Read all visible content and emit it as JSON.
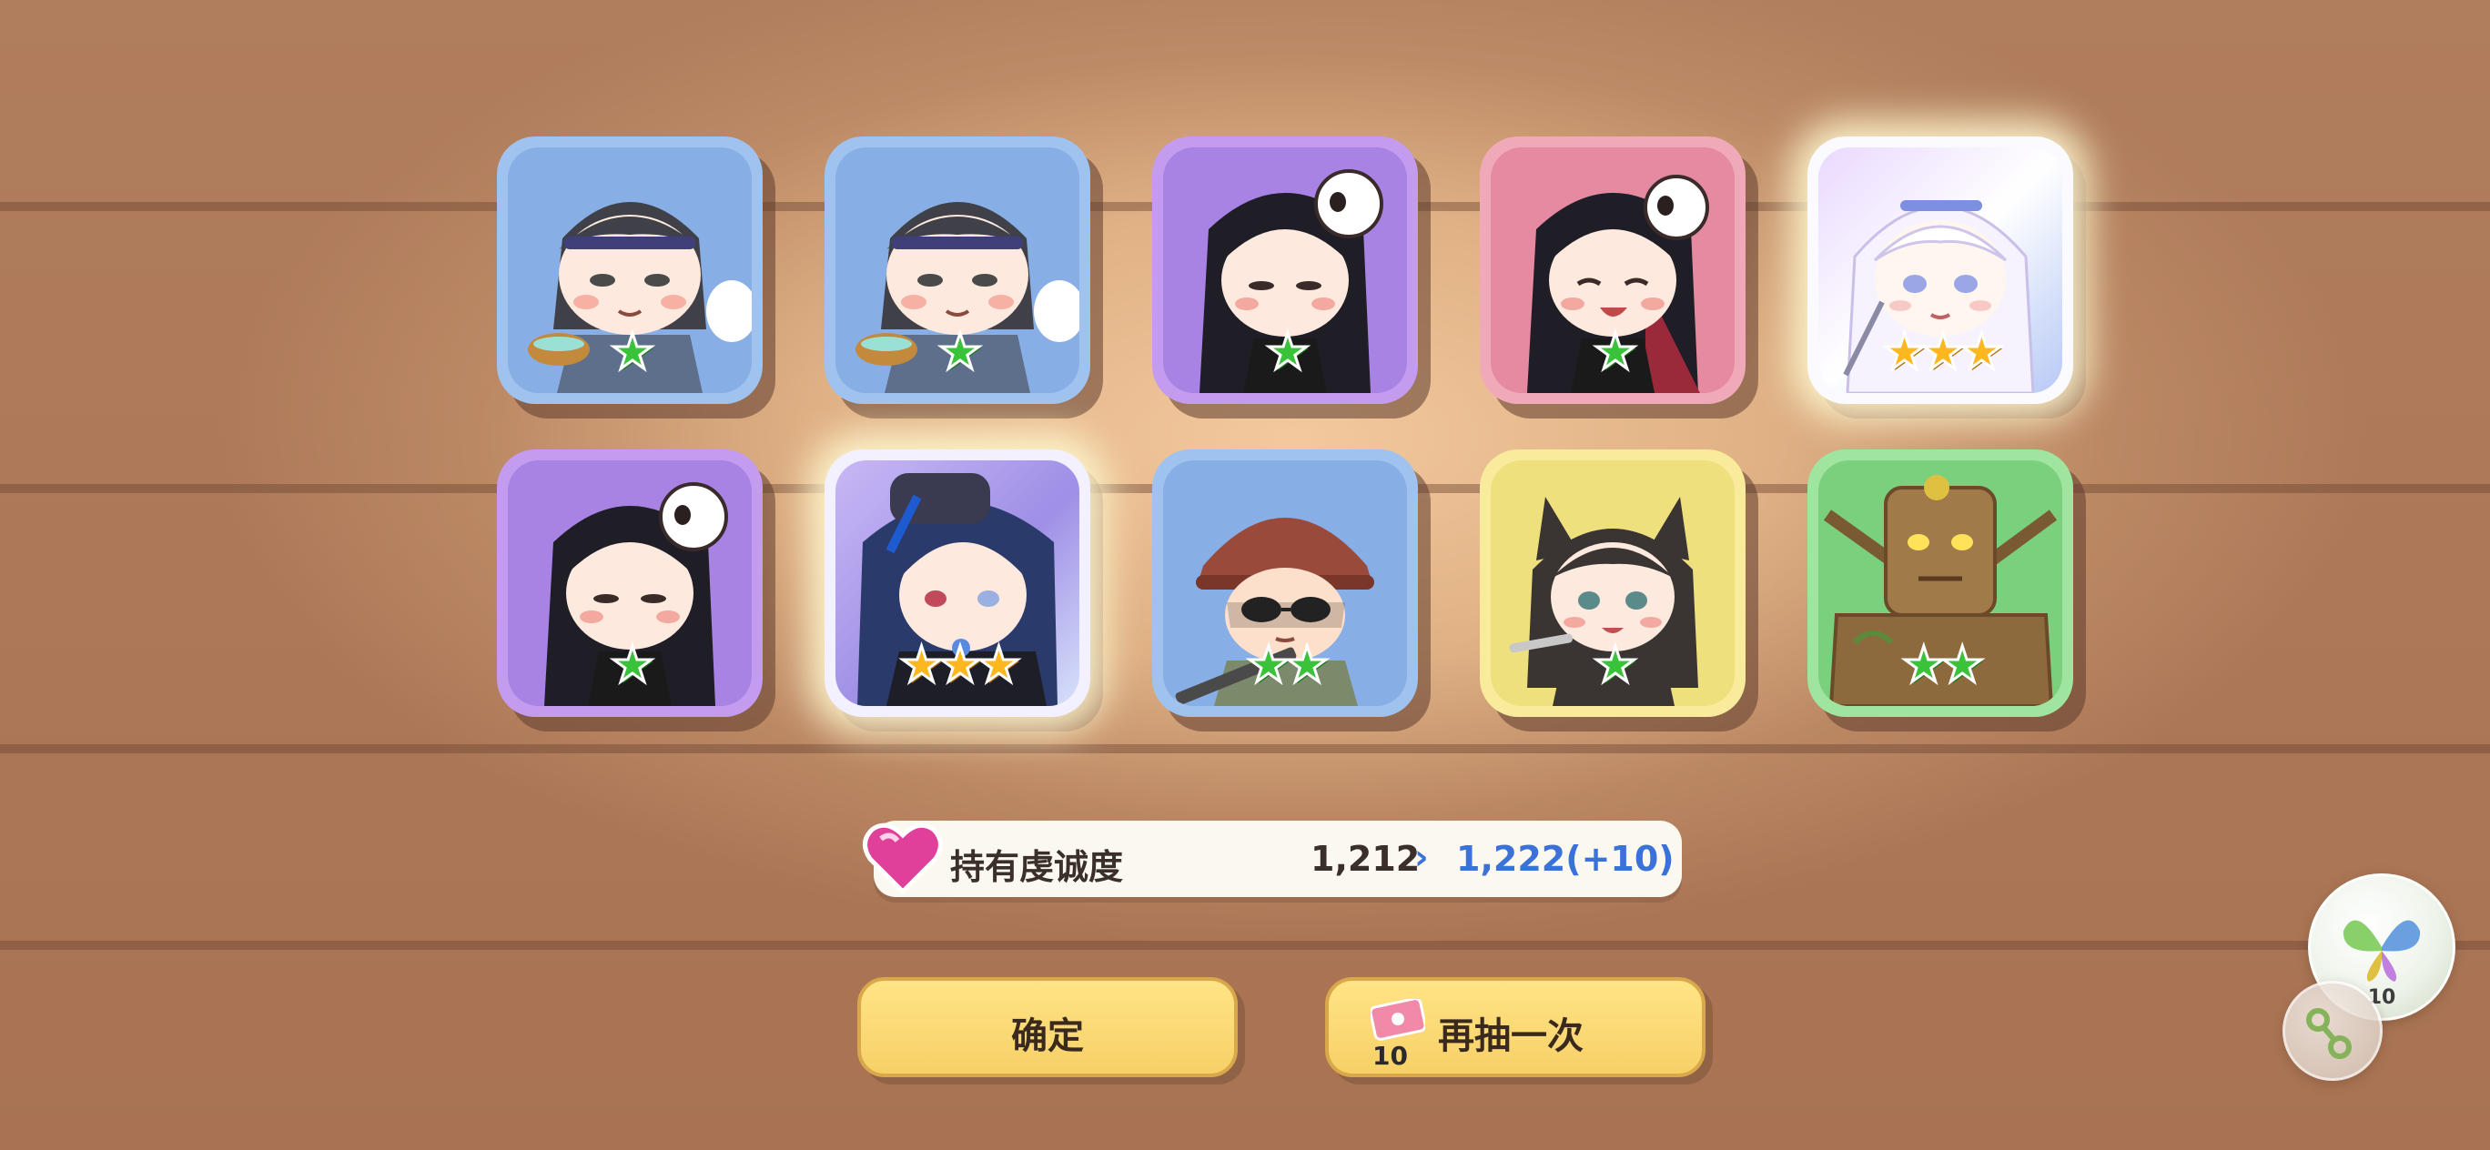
{
  "cards": [
    {
      "id": "card-1",
      "frame": "blue",
      "stars": 1,
      "star_color": "green",
      "character": "headband-girl"
    },
    {
      "id": "card-2",
      "frame": "blue",
      "stars": 1,
      "star_color": "green",
      "character": "headband-girl"
    },
    {
      "id": "card-3",
      "frame": "purple",
      "stars": 1,
      "star_color": "green",
      "character": "skull-girl"
    },
    {
      "id": "card-4",
      "frame": "pink",
      "stars": 1,
      "star_color": "green",
      "character": "skull-girl-laughing"
    },
    {
      "id": "card-5",
      "frame": "white-glow",
      "stars": 3,
      "star_color": "gold",
      "character": "white-haired-girl"
    },
    {
      "id": "card-6",
      "frame": "purple",
      "stars": 1,
      "star_color": "green",
      "character": "skull-girl"
    },
    {
      "id": "card-7",
      "frame": "lilac-glow",
      "stars": 3,
      "star_color": "gold",
      "character": "blue-haired-girl"
    },
    {
      "id": "card-8",
      "frame": "blue",
      "stars": 2,
      "star_color": "green",
      "character": "helmet-soldier"
    },
    {
      "id": "card-9",
      "frame": "yellow",
      "stars": 1,
      "star_color": "green",
      "character": "wolf-ear-girl"
    },
    {
      "id": "card-10",
      "frame": "green",
      "stars": 2,
      "star_color": "green",
      "character": "tree-golem"
    }
  ],
  "devotion": {
    "label": "持有虔诚度",
    "old_value": "1,212",
    "arrow": "›",
    "new_value": "1,222(+10)"
  },
  "buttons": {
    "confirm": "确定",
    "again": "再抽一次",
    "ticket_count": "10"
  },
  "bubble": {
    "butterfly_count": "10"
  },
  "colors": {
    "gold_star": "#ffb720",
    "green_star": "#3bc23b",
    "button_yellow": "#f7d067",
    "blue_text": "#3a72d8"
  }
}
